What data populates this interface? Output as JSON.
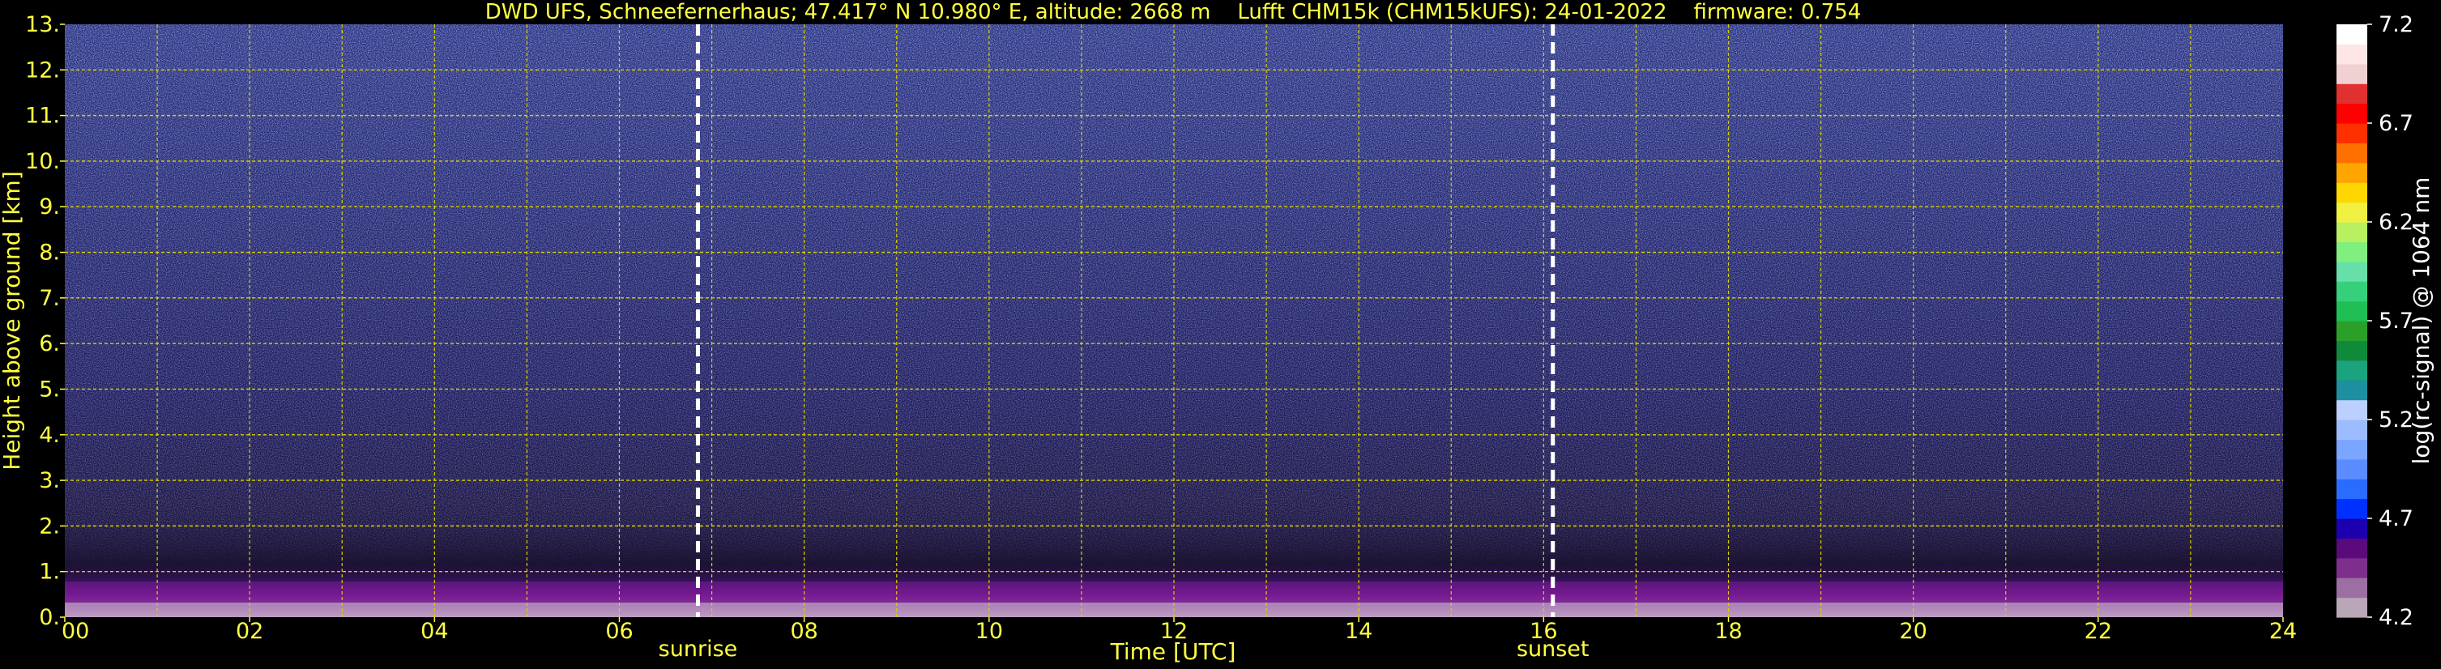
{
  "chart_data": {
    "type": "heatmap",
    "title": "DWD UFS, Schneefernerhaus; 47.417° N 10.980° E, altitude: 2668 m    Lufft CHM15k (CHM15kUFS): 24-01-2022    firmware: 0.754",
    "xlabel": "Time [UTC]",
    "ylabel": "Height above ground [km]",
    "xlim": [
      0,
      24
    ],
    "ylim": [
      0,
      13
    ],
    "xticks": [
      "00",
      "02",
      "04",
      "06",
      "08",
      "10",
      "12",
      "14",
      "16",
      "18",
      "20",
      "22",
      "24"
    ],
    "yticks": [
      "0.",
      "1.",
      "2.",
      "3.",
      "4.",
      "5.",
      "6.",
      "7.",
      "8.",
      "9.",
      "10.",
      "11.",
      "12.",
      "13."
    ],
    "grid": true,
    "grid_minor_x": true,
    "events": [
      {
        "label": "sunrise",
        "time": 6.85
      },
      {
        "label": "sunset",
        "time": 16.1
      }
    ],
    "colorbar": {
      "label": "log(rc-signal) @ 1064 nm",
      "range": [
        4.2,
        7.2
      ],
      "ticks": [
        "4.2",
        "4.7",
        "5.2",
        "5.7",
        "6.2",
        "6.7",
        "7.2"
      ],
      "colors": [
        "#b9a7b8",
        "#9b6fa3",
        "#7e2f8e",
        "#5a0a7a",
        "#1c00b0",
        "#0030ff",
        "#2a6cff",
        "#5a8cff",
        "#7aa6ff",
        "#9cbcff",
        "#bcd0ff",
        "#1e8fa0",
        "#1aa37d",
        "#0f8a3a",
        "#2aa02a",
        "#1fbf55",
        "#34d07a",
        "#66e0a8",
        "#7ff07f",
        "#b8f060",
        "#f0f040",
        "#ffd700",
        "#ffa500",
        "#ff7000",
        "#ff3000",
        "#ff0000",
        "#e03030",
        "#f0d0d0",
        "#ffe6e6",
        "#ffffff"
      ]
    },
    "field_description": "Profile density colored by log signal: deep purple/magenta boundary layer near ground (0-0.8 km), purple-violet noise 0.8-2 km, dark blue-violet noise with blue/cyan speckle above 2 km."
  }
}
